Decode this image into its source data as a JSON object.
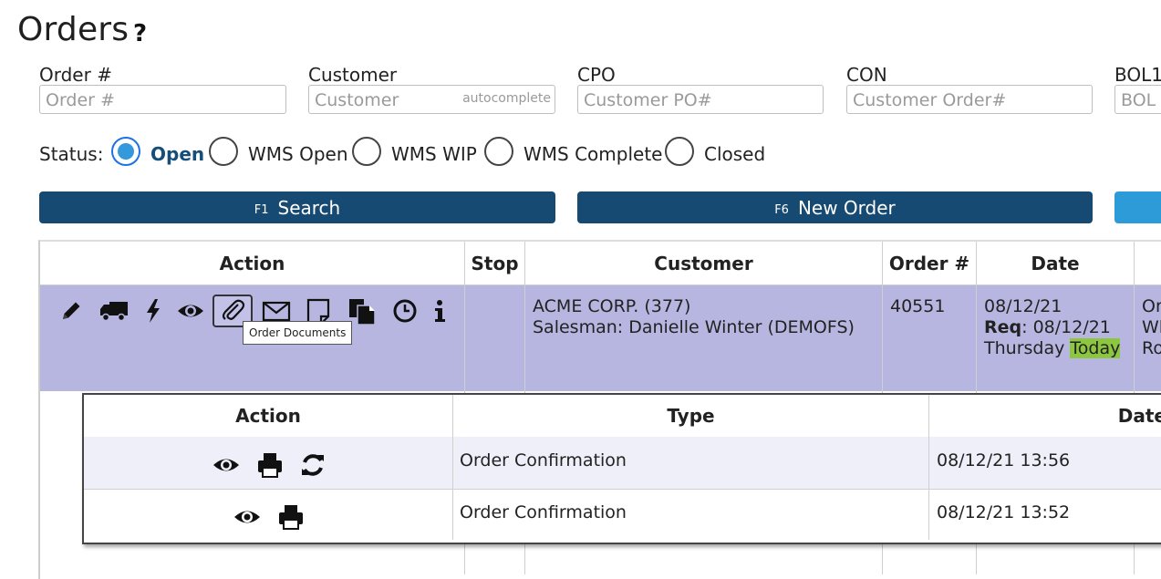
{
  "page": {
    "title": "Orders",
    "help_icon": "?"
  },
  "filters": {
    "order": {
      "label": "Order #",
      "placeholder": "Order #"
    },
    "customer": {
      "label": "Customer",
      "placeholder": "Customer",
      "hint": "autocomplete"
    },
    "cpo": {
      "label": "CPO",
      "placeholder": "Customer PO#"
    },
    "con": {
      "label": "CON",
      "placeholder": "Customer Order#"
    },
    "bol": {
      "label": "BOL1",
      "placeholder": "BOL"
    }
  },
  "status": {
    "label": "Status:",
    "options": [
      "Open",
      "WMS Open",
      "WMS WIP",
      "WMS Complete",
      "Closed"
    ],
    "selected": "Open"
  },
  "buttons": {
    "search": {
      "key": "F1",
      "label": "Search"
    },
    "new_order": {
      "key": "F6",
      "label": "New Order"
    }
  },
  "table": {
    "headers": [
      "Action",
      "Stop",
      "Customer",
      "Order #",
      "Date"
    ],
    "row": {
      "action_icons": [
        "pencil-icon",
        "truck-icon",
        "bolt-icon",
        "eye-icon",
        "paperclip-icon",
        "envelope-icon",
        "note-icon",
        "copy-icon",
        "clock-icon",
        "info-icon"
      ],
      "customer_line1": "ACME CORP. (377)",
      "customer_line2": "Salesman: Danielle Winter (DEMOFS)",
      "order_number": "40551",
      "date": "08/12/21",
      "req_label": "Req",
      "req_date": ": 08/12/21",
      "weekday": "Thursday",
      "today": "Today",
      "overflow_col": [
        "Or",
        "Wl",
        "Ro"
      ]
    },
    "tooltip": "Order Documents"
  },
  "documents": {
    "headers": [
      "Action",
      "Type",
      "Date"
    ],
    "rows": [
      {
        "actions": [
          "eye-icon",
          "print-icon",
          "refresh-icon"
        ],
        "type": "Order Confirmation",
        "date": "08/12/21 13:56"
      },
      {
        "actions": [
          "eye-icon",
          "print-icon"
        ],
        "type": "Order Confirmation",
        "date": "08/12/21 13:52"
      }
    ]
  }
}
